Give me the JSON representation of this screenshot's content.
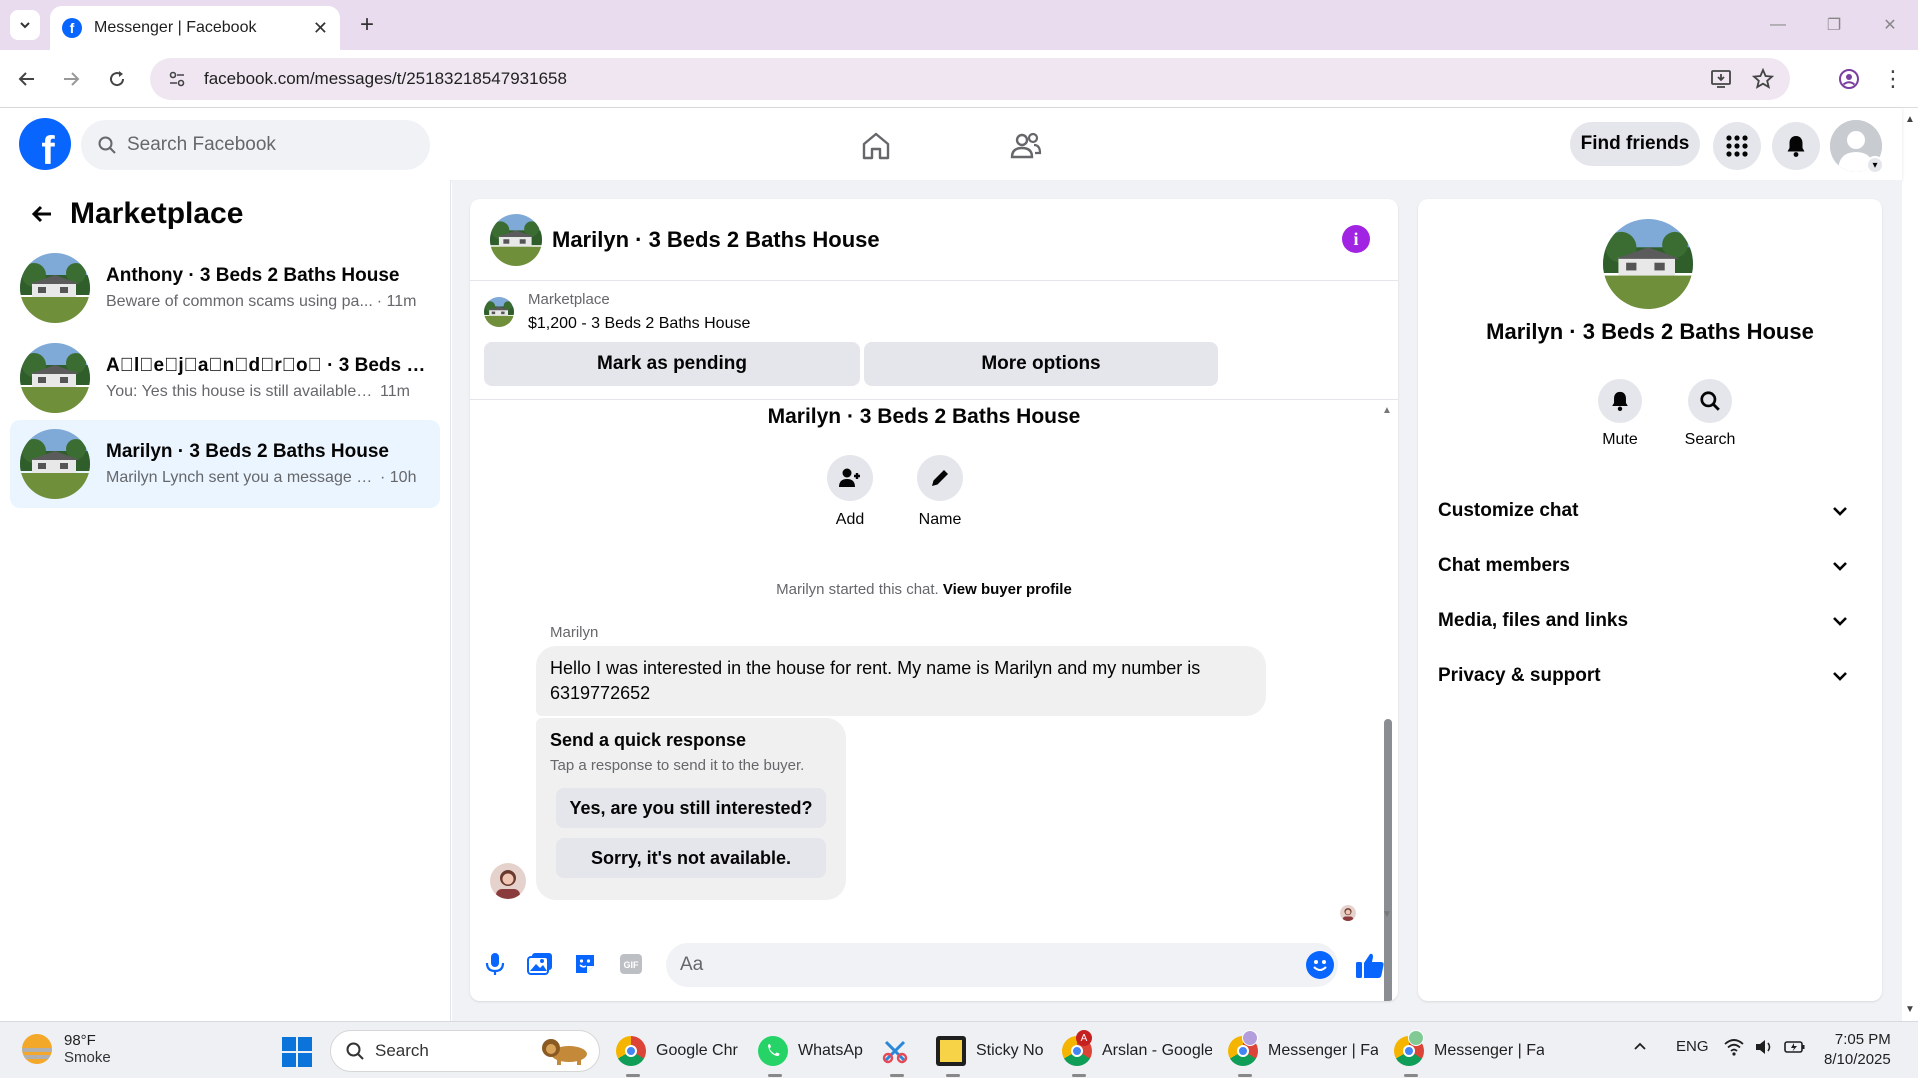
{
  "browser": {
    "tab_title": "Messenger | Facebook",
    "url": "facebook.com/messages/t/25183218547931658"
  },
  "header": {
    "search_placeholder": "Search Facebook",
    "find_friends_label": "Find friends"
  },
  "sidebar": {
    "title": "Marketplace",
    "conversations": [
      {
        "name": "Anthony · 3 Beds 2 Baths House",
        "snippet": "Beware of common scams using pa...",
        "time": "· 11m",
        "active": false
      },
      {
        "name": "A\u0000l\u0000e\u0000j\u0000a\u0000n\u0000d\u0000r\u0000o\u0000 · 3 Beds 2 B...",
        "snippet": "You: Yes this house is still available f...",
        "time": "11m",
        "active": false
      },
      {
        "name": "Marilyn · 3 Beds 2 Baths House",
        "snippet": "Marilyn Lynch sent you a message a...",
        "time": "· 10h",
        "active": true
      }
    ]
  },
  "chat": {
    "title": "Marilyn · 3 Beds 2 Baths House",
    "listing_label": "Marketplace",
    "listing_price": "$1,200 - 3 Beds 2 Baths House",
    "mark_pending_label": "Mark as pending",
    "more_options_label": "More options",
    "intro_title": "Marilyn · 3 Beds 2 Baths House",
    "add_label": "Add",
    "name_label": "Name",
    "started_text": "Marilyn started this chat.",
    "view_buyer_profile": "View buyer profile",
    "sender_name": "Marilyn",
    "message": "Hello I was interested in the house for rent. My name is Marilyn and my number is 6319772652",
    "quick_response_title": "Send a quick response",
    "quick_response_sub": "Tap a response to send it to the buyer.",
    "quick_reply_1": "Yes, are you still interested?",
    "quick_reply_2": "Sorry, it's not available.",
    "composer_placeholder": "Aa"
  },
  "info_panel": {
    "name": "Marilyn · 3 Beds 2 Baths House",
    "mute_label": "Mute",
    "search_label": "Search",
    "rows": [
      "Customize chat",
      "Chat members",
      "Media, files and links",
      "Privacy & support"
    ]
  },
  "taskbar": {
    "temperature": "98°F",
    "weather": "Smoke",
    "search_label": "Search",
    "apps": [
      "Google Chr",
      "WhatsAp",
      "Sticky No",
      "Arslan - Google",
      "Messenger | Fa",
      "Messenger | Fa"
    ],
    "language": "ENG",
    "time": "7:05 PM",
    "date": "8/10/2025"
  },
  "colors": {
    "facebook_blue": "#0866ff",
    "info_purple": "#a224e3",
    "active_conversation": "#ebf5ff",
    "chrome_tabbar": "#e9dcee"
  }
}
